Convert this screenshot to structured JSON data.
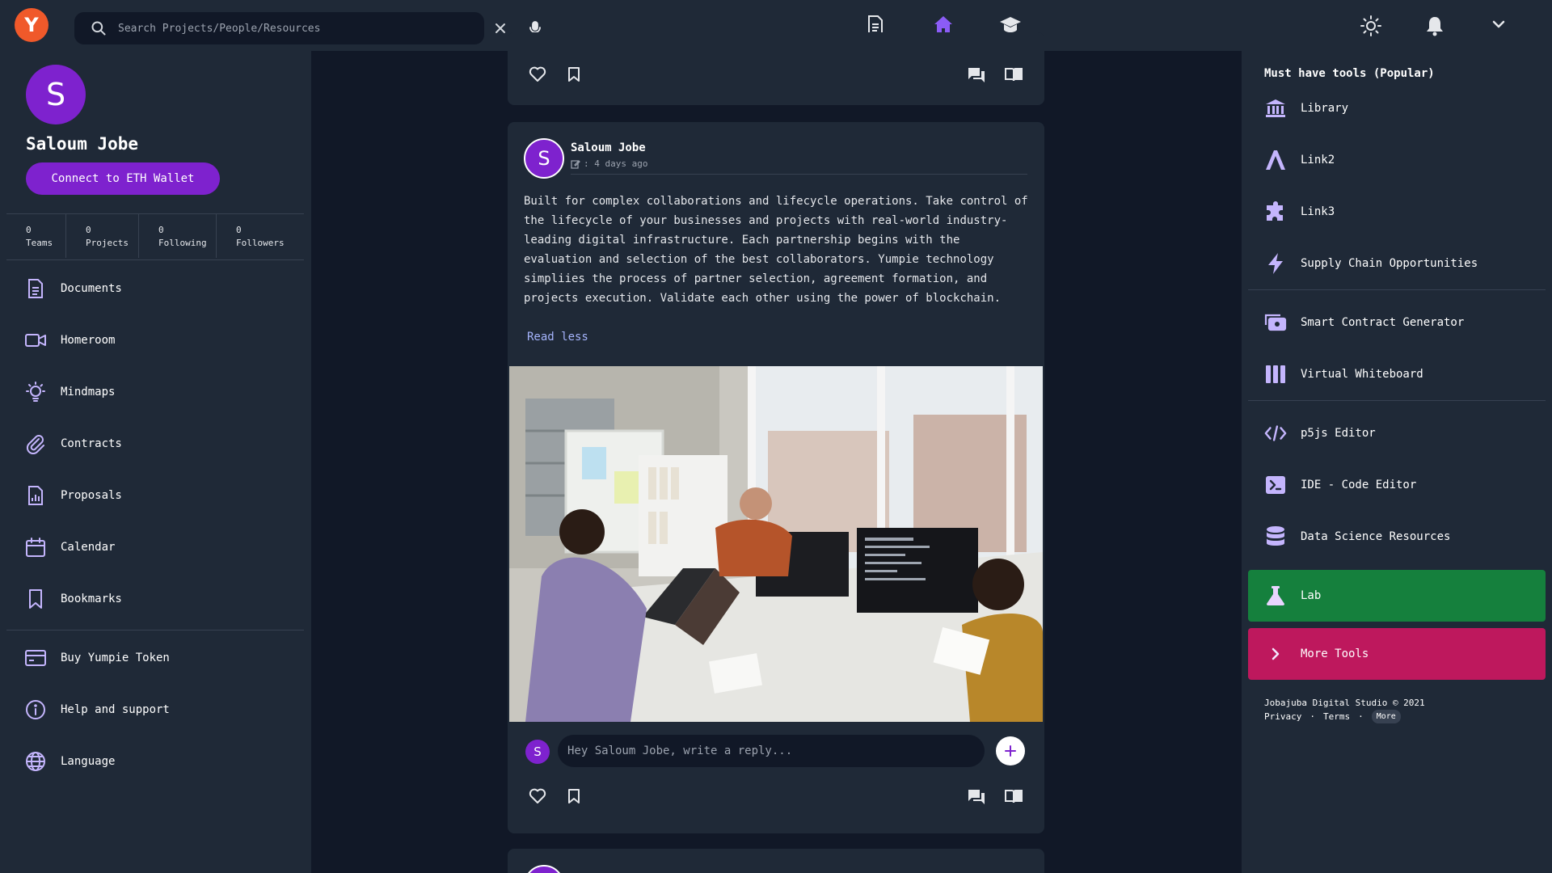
{
  "app": {
    "logo_letter": "Y",
    "accent": "#7e22ce"
  },
  "search": {
    "placeholder": "Search Projects/People/Resources"
  },
  "nav": {
    "icons": [
      "document-icon",
      "home-icon",
      "graduation-cap-icon"
    ],
    "active": "home-icon"
  },
  "profile": {
    "avatar_letter": "S",
    "name": "Saloum Jobe",
    "wallet_button": "Connect to ETH Wallet",
    "stats": [
      {
        "value": "0",
        "label": "Teams"
      },
      {
        "value": "0",
        "label": "Projects"
      },
      {
        "value": "0",
        "label": "Following"
      },
      {
        "value": "0",
        "label": "Followers"
      }
    ]
  },
  "sidebar": {
    "items": [
      {
        "label": "Documents",
        "icon": "document-icon"
      },
      {
        "label": "Homeroom",
        "icon": "video-icon"
      },
      {
        "label": "Mindmaps",
        "icon": "lightbulb-icon"
      },
      {
        "label": "Contracts",
        "icon": "paperclip-icon"
      },
      {
        "label": "Proposals",
        "icon": "chart-document-icon"
      },
      {
        "label": "Calendar",
        "icon": "calendar-icon"
      },
      {
        "label": "Bookmarks",
        "icon": "bookmark-icon"
      }
    ],
    "extra": [
      {
        "label": "Buy Yumpie Token",
        "icon": "credit-card-icon"
      },
      {
        "label": "Help and support",
        "icon": "info-icon"
      },
      {
        "label": "Language",
        "icon": "globe-icon"
      }
    ]
  },
  "post": {
    "avatar_letter": "S",
    "author": "Saloum Jobe",
    "time": ": 4 days ago",
    "body": "Built for complex collaborations and lifecycle operations. Take control of the lifecycle of your businesses and projects with real-world industry-leading digital infrastructure. Each partnership begins with the evaluation and selection of the best collaborators. Yumpie technology simpliies the process of partner selection, agreement formation, and projects execution. Validate each other using the power of blockchain.",
    "read_less": "Read less",
    "reply_avatar_letter": "S",
    "reply_placeholder": "Hey Saloum Jobe, write a reply..."
  },
  "tools": {
    "title": "Must have tools (Popular)",
    "items": [
      {
        "label": "Library",
        "icon": "library-icon"
      },
      {
        "label": "Link2",
        "icon": "a-letter-icon"
      },
      {
        "label": "Link3",
        "icon": "puzzle-icon"
      },
      {
        "label": "Supply Chain Opportunities",
        "icon": "lightning-icon"
      },
      {
        "label": "Smart Contract Generator",
        "icon": "cash-icon"
      },
      {
        "label": "Virtual Whiteboard",
        "icon": "columns-icon"
      },
      {
        "label": "p5js Editor",
        "icon": "code-icon"
      },
      {
        "label": "IDE - Code Editor",
        "icon": "terminal-icon"
      },
      {
        "label": "Data Science Resources",
        "icon": "database-icon"
      }
    ],
    "lab": {
      "label": "Lab",
      "icon": "beaker-icon",
      "color": "#15803d"
    },
    "more": {
      "label": "More Tools",
      "icon": "chevron-right-icon",
      "color": "#be185d"
    }
  },
  "footer": {
    "copyright": "Jobajuba Digital Studio © 2021",
    "privacy": "Privacy",
    "terms": "Terms",
    "more": "More",
    "separator": "·"
  }
}
